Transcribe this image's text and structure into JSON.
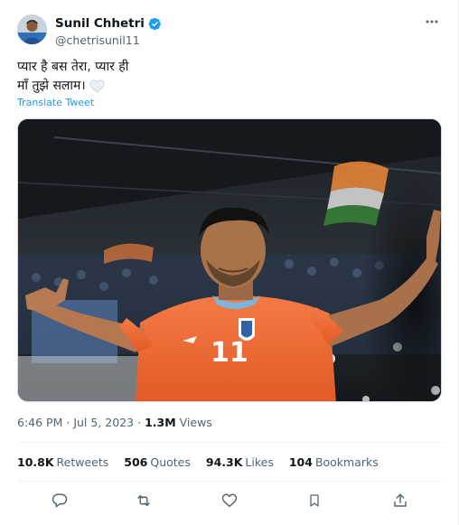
{
  "tweet": {
    "author": {
      "display_name": "Sunil Chhetri",
      "handle": "@chetrisunil11",
      "verified": true
    },
    "text_line1": "प्यार है बस तेरा, प्यार ही",
    "text_line2": "माँ तुझे सलाम।",
    "translate_label": "Translate Tweet",
    "time": "6:46 PM",
    "separator": "·",
    "date": "Jul 5, 2023",
    "views_count": "1.3M",
    "views_label": "Views",
    "stats": {
      "retweets_count": "10.8K",
      "retweets_label": "Retweets",
      "quotes_count": "506",
      "quotes_label": "Quotes",
      "likes_count": "94.3K",
      "likes_label": "Likes",
      "bookmarks_count": "104",
      "bookmarks_label": "Bookmarks"
    },
    "jersey_number": "11"
  },
  "colors": {
    "accent": "#1d9bf0",
    "text_primary": "#0f1419",
    "text_secondary": "#536471",
    "jersey": "#ef6a36"
  }
}
